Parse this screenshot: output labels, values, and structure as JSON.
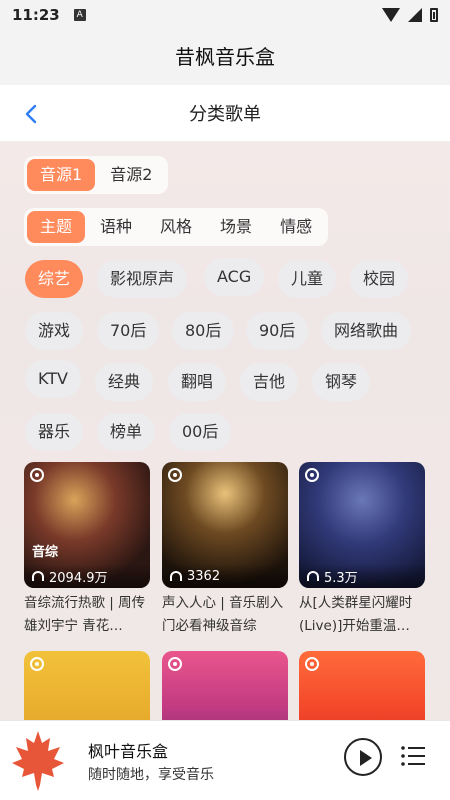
{
  "status_bar": {
    "time": "11:23",
    "a_badge": "A"
  },
  "app": {
    "title": "昔枫音乐盒"
  },
  "nav": {
    "title": "分类歌单",
    "back_icon": "chevron-left-icon"
  },
  "source_tabs": {
    "items": [
      "音源1",
      "音源2"
    ],
    "active": 0
  },
  "category_tabs": {
    "items": [
      "主题",
      "语种",
      "风格",
      "场景",
      "情感"
    ],
    "active": 0
  },
  "tags": {
    "active": 0,
    "items": [
      "综艺",
      "影视原声",
      "ACG",
      "儿童",
      "校园",
      "游戏",
      "70后",
      "80后",
      "90后",
      "网络歌曲",
      "KTV",
      "经典",
      "翻唱",
      "吉他",
      "钢琴",
      "器乐",
      "榜单",
      "00后"
    ]
  },
  "playlists": [
    {
      "tag": "音综",
      "plays": "2094.9万",
      "title": "音综流行热歌 | 周传雄刘宇宁 青花…",
      "icon": "headphones-icon"
    },
    {
      "tag": "",
      "plays": "3362",
      "title": "声入人心 | 音乐剧入门必看神级音综",
      "icon": "headphones-icon"
    },
    {
      "tag": "",
      "plays": "5.3万",
      "title": "从[人类群星闪耀时(Live)]开始重温…",
      "icon": "headphones-icon"
    },
    {
      "tag": "",
      "plays": "",
      "title": "",
      "icon": ""
    },
    {
      "tag": "",
      "plays": "",
      "title": "",
      "icon": ""
    },
    {
      "tag": "",
      "plays": "",
      "title": "",
      "icon": ""
    }
  ],
  "player": {
    "name": "枫叶音乐盒",
    "subtitle": "随时随地，享受音乐",
    "play_icon": "play-icon",
    "list_icon": "playlist-icon"
  },
  "colors": {
    "accent": "#ff8a5c",
    "chip_bg": "#ebecf0"
  }
}
